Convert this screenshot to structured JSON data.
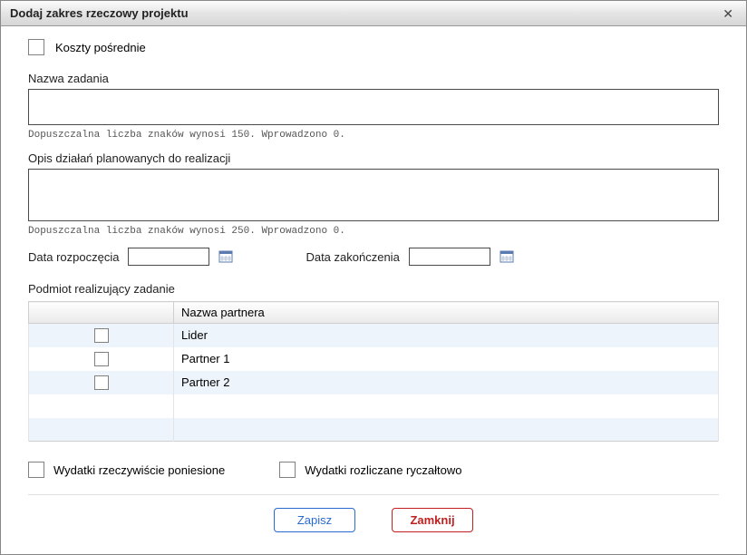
{
  "title": "Dodaj zakres rzeczowy projektu",
  "direct_costs_label": "Koszty pośrednie",
  "task_name": {
    "label": "Nazwa zadania",
    "value": "",
    "hint": "Dopuszczalna liczba znaków wynosi 150. Wprowadzono 0."
  },
  "description": {
    "label": "Opis działań planowanych do realizacji",
    "value": "",
    "hint": "Dopuszczalna liczba znaków wynosi 250. Wprowadzono 0."
  },
  "date_start": {
    "label": "Data rozpoczęcia",
    "value": ""
  },
  "date_end": {
    "label": "Data zakończenia",
    "value": ""
  },
  "subject": {
    "label": "Podmiot realizujący zadanie",
    "header_partner": "Nazwa partnera",
    "rows": [
      {
        "name": "Lider"
      },
      {
        "name": "Partner 1"
      },
      {
        "name": "Partner 2"
      }
    ]
  },
  "expenses": {
    "actual": "Wydatki rzeczywiście poniesione",
    "lump": "Wydatki rozliczane ryczałtowo"
  },
  "buttons": {
    "save": "Zapisz",
    "close": "Zamknij"
  }
}
